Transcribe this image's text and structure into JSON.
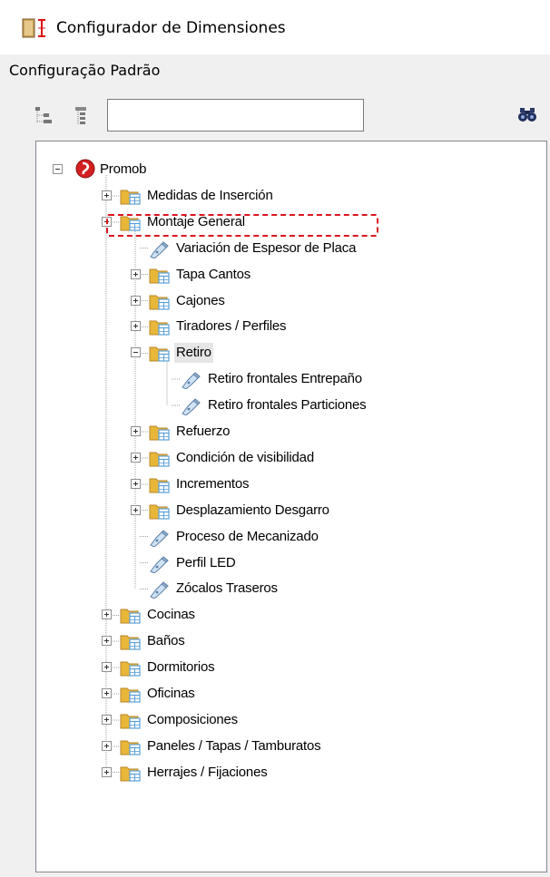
{
  "window": {
    "title": "Configurador de Dimensiones"
  },
  "section": {
    "label": "Configuração Padrão"
  },
  "toolbar": {
    "search_value": "",
    "search_placeholder": ""
  },
  "tree": {
    "nodes": [
      {
        "id": "promob",
        "label": "Promob",
        "level": 0,
        "type": "root",
        "state": "expanded"
      },
      {
        "id": "medidas-insercion",
        "label": "Medidas de Inserción",
        "level": 1,
        "type": "folder",
        "state": "collapsed"
      },
      {
        "id": "montaje-general",
        "label": "Montaje General",
        "level": 1,
        "type": "folder",
        "state": "expanded"
      },
      {
        "id": "variacion-espesor",
        "label": "Variación de Espesor de Placa",
        "level": 2,
        "type": "item",
        "state": "leaf"
      },
      {
        "id": "tapa-cantos",
        "label": "Tapa Cantos",
        "level": 2,
        "type": "folder",
        "state": "collapsed"
      },
      {
        "id": "cajones",
        "label": "Cajones",
        "level": 2,
        "type": "folder",
        "state": "collapsed"
      },
      {
        "id": "tiradores-perfiles",
        "label": "Tiradores / Perfiles",
        "level": 2,
        "type": "folder",
        "state": "collapsed"
      },
      {
        "id": "retiro",
        "label": "Retiro",
        "level": 2,
        "type": "folder",
        "state": "expanded",
        "selected": true
      },
      {
        "id": "retiro-entrepano",
        "label": "Retiro frontales Entrepaño",
        "level": 3,
        "type": "item",
        "state": "leaf",
        "highlighted": true
      },
      {
        "id": "retiro-particiones",
        "label": "Retiro frontales Particiones",
        "level": 3,
        "type": "item",
        "state": "leaf"
      },
      {
        "id": "refuerzo",
        "label": "Refuerzo",
        "level": 2,
        "type": "folder",
        "state": "collapsed"
      },
      {
        "id": "condicion-visibilidad",
        "label": "Condición de visibilidad",
        "level": 2,
        "type": "folder",
        "state": "collapsed"
      },
      {
        "id": "incrementos",
        "label": "Incrementos",
        "level": 2,
        "type": "folder",
        "state": "collapsed"
      },
      {
        "id": "desplazamiento-desgarro",
        "label": "Desplazamiento Desgarro",
        "level": 2,
        "type": "folder",
        "state": "collapsed"
      },
      {
        "id": "proceso-mecanizado",
        "label": "Proceso de Mecanizado",
        "level": 2,
        "type": "item",
        "state": "leaf"
      },
      {
        "id": "perfil-led",
        "label": "Perfil LED",
        "level": 2,
        "type": "item",
        "state": "leaf"
      },
      {
        "id": "zocalos-traseros",
        "label": "Zócalos Traseros",
        "level": 2,
        "type": "item",
        "state": "leaf"
      },
      {
        "id": "cocinas",
        "label": "Cocinas",
        "level": 1,
        "type": "folder",
        "state": "collapsed"
      },
      {
        "id": "banos",
        "label": "Baños",
        "level": 1,
        "type": "folder",
        "state": "collapsed"
      },
      {
        "id": "dormitorios",
        "label": "Dormitorios",
        "level": 1,
        "type": "folder",
        "state": "collapsed"
      },
      {
        "id": "oficinas",
        "label": "Oficinas",
        "level": 1,
        "type": "folder",
        "state": "collapsed"
      },
      {
        "id": "composiciones",
        "label": "Composiciones",
        "level": 1,
        "type": "folder",
        "state": "collapsed"
      },
      {
        "id": "paneles-tapas",
        "label": "Paneles / Tapas / Tamburatos",
        "level": 1,
        "type": "folder",
        "state": "collapsed"
      },
      {
        "id": "herrajes-fijaciones",
        "label": "Herrajes / Fijaciones",
        "level": 1,
        "type": "folder",
        "state": "collapsed"
      }
    ]
  },
  "colors": {
    "folder": "#e8b73a",
    "sheet": "#5a9fd6",
    "root": "#d32020",
    "highlight_border": "#d9171f",
    "selection": "#e6e6e6"
  }
}
